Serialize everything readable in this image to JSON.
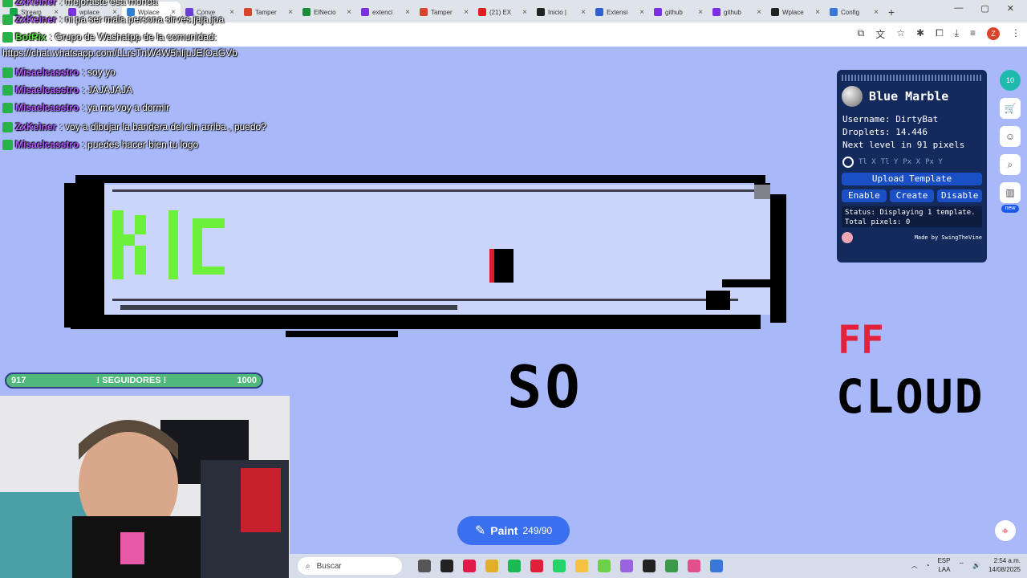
{
  "browser": {
    "tabs": [
      {
        "label": "Stream",
        "color": "#1aa34a",
        "active": false
      },
      {
        "label": "wplace",
        "color": "#7b2fe0",
        "active": false
      },
      {
        "label": "Wplace",
        "color": "#2c80d8",
        "active": true
      },
      {
        "label": "Conve",
        "color": "#6b3fd6",
        "active": false
      },
      {
        "label": "Tamper",
        "color": "#d6462f",
        "active": false
      },
      {
        "label": "ElNecio",
        "color": "#1a8d3a",
        "active": false
      },
      {
        "label": "extenci",
        "color": "#7b2fe0",
        "active": false
      },
      {
        "label": "Tamper",
        "color": "#d6462f",
        "active": false
      },
      {
        "label": "(21) EX",
        "color": "#e02020",
        "active": false
      },
      {
        "label": "Inicio |",
        "color": "#222222",
        "active": false
      },
      {
        "label": "Extensi",
        "color": "#3060d0",
        "active": false
      },
      {
        "label": "github",
        "color": "#7b2fe0",
        "active": false
      },
      {
        "label": "github",
        "color": "#7b2fe0",
        "active": false
      },
      {
        "label": "Wplace",
        "color": "#222222",
        "active": false
      },
      {
        "label": "Config",
        "color": "#3a78d8",
        "active": false
      }
    ],
    "new_tab": "+",
    "profile_initial": "Z"
  },
  "chat": [
    {
      "user": "ZxKeiner",
      "user_color": "purple",
      "text": ": mejorasté esa monda"
    },
    {
      "user": "ZxKeiner",
      "user_color": "purple",
      "text": ": ni pa ser mala persona sirves jaja joa"
    },
    {
      "user": "BotRix",
      "user_color": "green",
      "text": ": Grupo de Washatpp de la comunidad:"
    },
    {
      "user": "",
      "user_color": "purple",
      "text": "https://chat.whatsapp.com/LLrsTnW4W5hIjuJEIOaGVb"
    },
    {
      "user": "Misaelcasstro",
      "user_color": "purple",
      "text": ": soy yo"
    },
    {
      "user": "Misaelcasstro",
      "user_color": "purple",
      "text": ": JAJAJAJA"
    },
    {
      "user": "Misaelcasstro",
      "user_color": "purple",
      "text": ": ya me voy a dormir"
    },
    {
      "user": "ZxKeiner",
      "user_color": "purple",
      "text": ": voy a dibujar la bandera del eln arriba , puedo?"
    },
    {
      "user": "Misaelcasstro",
      "user_color": "purple",
      "text": ": puedes hacer bien tu logo"
    }
  ],
  "canvas": {
    "banner_text": "KIC",
    "so_text": "SO",
    "ff_text": "FF",
    "cloud_text": "CLOUD"
  },
  "blue_marble": {
    "title": "Blue Marble",
    "username_line": "Username: DirtyBat",
    "droplets_line": "Droplets: 14.446",
    "level_line": "Next level in 91 pixels",
    "coords": [
      "Tl X",
      "Tl Y",
      "Px X",
      "Px Y"
    ],
    "upload_label": "Upload Template",
    "enable_label": "Enable",
    "create_label": "Create",
    "disable_label": "Disable",
    "status_text": "Status: Displaying 1 template. Total pixels: 0",
    "made_by": "Made by SwingTheVine"
  },
  "tools": {
    "avatar_level": "10",
    "new_badge": "new"
  },
  "followers": {
    "current": "917",
    "label": "! SEGUIDORES !",
    "goal": "1000",
    "progress": 0.917
  },
  "paint": {
    "label": "Paint",
    "count": "249/90"
  },
  "taskbar": {
    "search_placeholder": "Buscar",
    "lang_top": "ESP",
    "lang_bottom": "LAA",
    "time": "2:54 a.m.",
    "date": "14/08/2025"
  }
}
